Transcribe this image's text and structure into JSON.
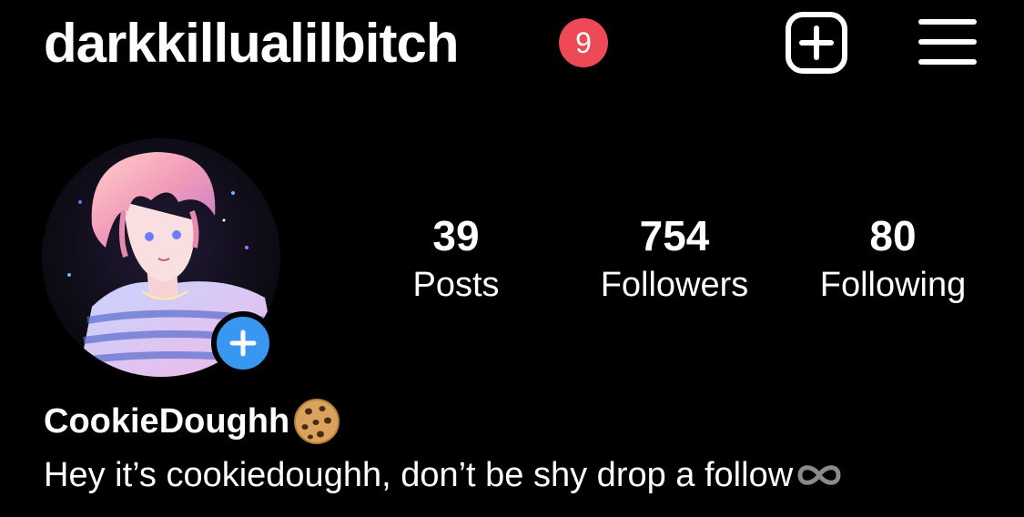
{
  "header": {
    "username": "darkkillualilbitch",
    "notification_count": "9",
    "new_post_icon": "plus-square-icon",
    "menu_icon": "hamburger-menu-icon"
  },
  "profile": {
    "avatar": "anime-character-avatar",
    "add_story_icon": "plus-icon",
    "display_name": "CookieDoughh",
    "display_name_emoji": "cookie-emoji",
    "bio": "Hey it’s cookiedoughh, don’t be shy drop a follow",
    "bio_emoji": "infinity-icon"
  },
  "stats": {
    "posts": {
      "value": "39",
      "label": "Posts"
    },
    "followers": {
      "value": "754",
      "label": "Followers"
    },
    "following": {
      "value": "80",
      "label": "Following"
    }
  },
  "colors": {
    "background": "#000000",
    "text": "#ffffff",
    "badge": "#ed4956",
    "add_story": "#3897f0"
  }
}
